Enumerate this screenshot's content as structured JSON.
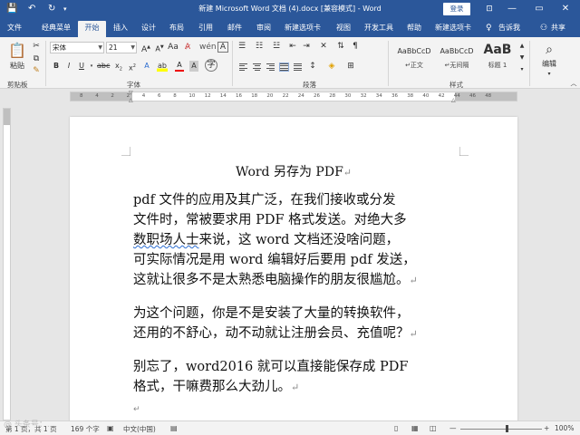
{
  "window": {
    "title": "新建 Microsoft Word 文档 (4).docx [兼容模式] - Word",
    "login": "登录",
    "minimize": "—",
    "restore": "▭",
    "close": "✕"
  },
  "quick_access": {
    "save": "💾",
    "undo": "↶",
    "redo": "↻"
  },
  "menu": {
    "tabs": [
      "文件",
      "经典菜单",
      "开始",
      "插入",
      "设计",
      "布局",
      "引用",
      "邮件",
      "审阅",
      "新建选项卡",
      "视图",
      "开发工具",
      "帮助",
      "新建选项卡"
    ],
    "tell_me": "告诉我",
    "share": "共享"
  },
  "ribbon": {
    "clipboard": {
      "paste": "粘贴",
      "label": "剪贴板"
    },
    "font": {
      "family": "宋体",
      "size": "21",
      "label": "字体"
    },
    "paragraph": {
      "label": "段落"
    },
    "styles": {
      "label": "样式",
      "items": [
        {
          "sample": "AaBbCcD",
          "name": "↵正文"
        },
        {
          "sample": "AaBbCcD",
          "name": "↵无间隔"
        },
        {
          "sample": "AaB",
          "name": "标题 1"
        }
      ]
    },
    "editing": {
      "label": "编辑"
    }
  },
  "ruler": {
    "numbers": [
      "8",
      "4",
      "2",
      "2",
      "4",
      "6",
      "8",
      "10",
      "12",
      "14",
      "16",
      "18",
      "20",
      "22",
      "24",
      "26",
      "28",
      "30",
      "32",
      "34",
      "36",
      "38",
      "40",
      "42",
      "44",
      "46",
      "48"
    ]
  },
  "document": {
    "title": "Word 另存为 PDF",
    "paragraphs": [
      [
        "pdf 文件的应用及其广泛，在我们接收或分发",
        "文件时，常被要求用 PDF 格式发送。对绝大多",
        "数职场人士来说，这 word 文档还没啥问题，",
        "可实际情况是用 word 编辑好后要用 pdf 发送，",
        "这就让很多不是太熟悉电脑操作的朋友很尴尬。"
      ],
      [
        "为这个问题，你是不是安装了大量的转换软件，",
        "还用的不舒心，动不动就让注册会员、充值呢？"
      ],
      [
        "别忘了，word2016 就可以直接能保存成 PDF",
        "格式，干嘛费那么大劲儿。"
      ]
    ],
    "paragraph_mark": "↵"
  },
  "status": {
    "page": "第 1 页，共 1 页",
    "words": "169 个字",
    "language": "中文(中国)",
    "zoom": "100%",
    "zoom_minus": "—",
    "zoom_plus": "+"
  },
  "watermark": "@ 头条号：..."
}
